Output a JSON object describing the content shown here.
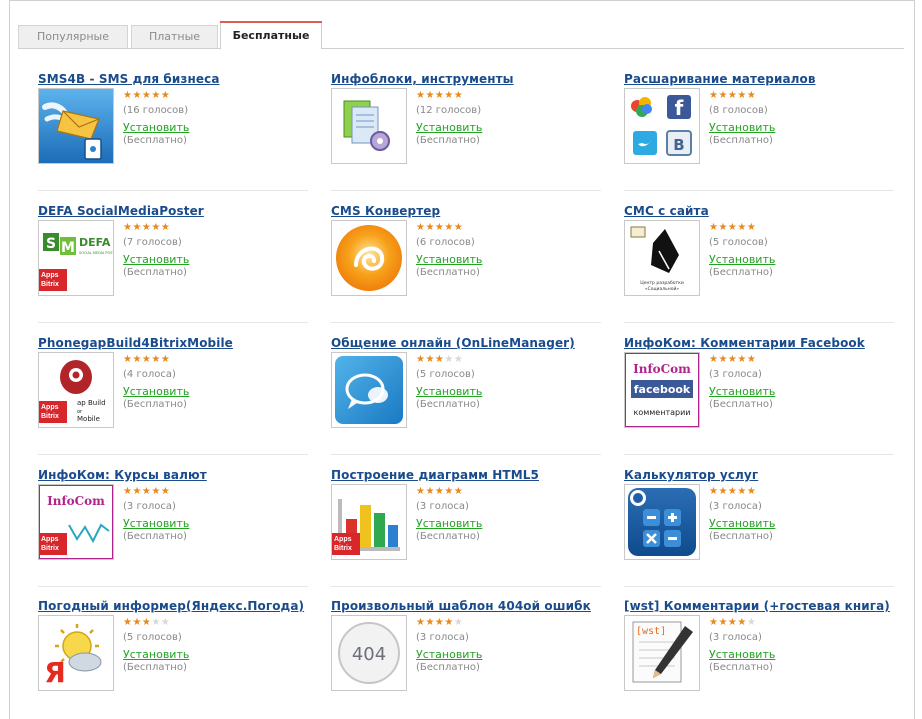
{
  "tabs": [
    {
      "label": "Популярные"
    },
    {
      "label": "Платные"
    },
    {
      "label": "Бесплатные"
    }
  ],
  "accent": "#e05a5a",
  "install_label": "Установить",
  "free_label": "(Бесплатно)",
  "modules": [
    {
      "title": "SMS4B - SMS для бизнеса",
      "votes": "(16 голосов)",
      "rating": 5,
      "icon": "envelope-bird-icon"
    },
    {
      "title": "Инфоблоки, инструменты",
      "votes": "(12 голосов)",
      "rating": 5,
      "icon": "documents-gear-icon"
    },
    {
      "title": "Расшаривание материалов",
      "votes": "(8 голосов)",
      "rating": 5,
      "icon": "social-networks-icon"
    },
    {
      "title": "DEFA SocialMediaPoster",
      "votes": "(7 голосов)",
      "rating": 5,
      "icon": "defa-logo-icon"
    },
    {
      "title": "CMS Конвертер",
      "votes": "(6 голосов)",
      "rating": 5,
      "icon": "orange-swirl-icon"
    },
    {
      "title": "СМС с сайта",
      "votes": "(5 голосов)",
      "rating": 5,
      "icon": "pen-nib-icon"
    },
    {
      "title": "PhonegapBuild4BitrixMobile",
      "votes": "(4 голоса)",
      "rating": 5,
      "icon": "phonegap-robot-icon"
    },
    {
      "title": "Общение онлайн (OnLineManager)",
      "votes": "(5 голосов)",
      "rating": 3,
      "icon": "chat-bubbles-icon"
    },
    {
      "title": "ИнфоКом: Комментарии Facebook",
      "votes": "(3 голоса)",
      "rating": 5,
      "icon": "infocom-facebook-icon"
    },
    {
      "title": "ИнфоКом: Курсы валют",
      "votes": "(3 голоса)",
      "rating": 5,
      "icon": "infocom-rates-icon"
    },
    {
      "title": "Построение диаграмм HTML5",
      "votes": "(3 голоса)",
      "rating": 5,
      "icon": "bar-chart-icon"
    },
    {
      "title": "Калькулятор услуг",
      "votes": "(3 голоса)",
      "rating": 5,
      "icon": "calculator-icon"
    },
    {
      "title": "Погодный информер(Яндекс.Погода)",
      "votes": "(5 голосов)",
      "rating": 3,
      "icon": "weather-sun-cloud-icon"
    },
    {
      "title": "Произвольный шаблон 404ой ошибк",
      "votes": "(3 голоса)",
      "rating": 4,
      "icon": "error-404-icon"
    },
    {
      "title": "[wst] Комментарии (+гостевая книга)",
      "votes": "(3 голоса)",
      "rating": 4,
      "icon": "notepad-pencil-icon"
    }
  ],
  "icon_text": {
    "defa_s": "S",
    "defa_m": "M",
    "defa_word": "DEFA",
    "defa_sub": "SOCIAL MEDIA POSTER",
    "bitrix_1": "Apps",
    "bitrix_2": "Bitrix",
    "phonegap_1": "ap Build",
    "phonegap_2": "or",
    "phonegap_3": "Mobile",
    "nib_caption_1": "Центр разработки",
    "nib_caption_2": "«Социальной»",
    "infocom": "InfoCom",
    "facebook": "facebook",
    "comments": "комментарии",
    "code_404": "404",
    "wst": "[wst]",
    "share_fb": "f",
    "share_b": "B",
    "yandex": "Я"
  }
}
